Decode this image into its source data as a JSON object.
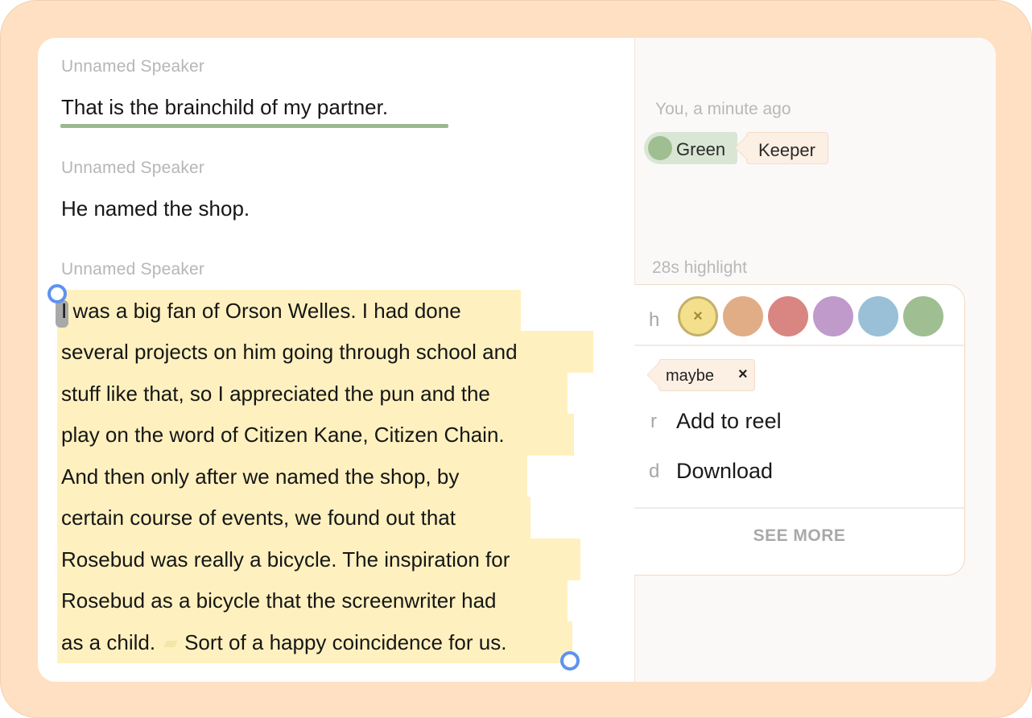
{
  "transcript": {
    "blocks": [
      {
        "speaker": "Unnamed Speaker",
        "text": "That is the brainchild of my partner."
      },
      {
        "speaker": "Unnamed Speaker",
        "text": "He named the shop."
      },
      {
        "speaker": "Unnamed Speaker",
        "lines": [
          "I was a big fan of Orson Welles. I had done",
          "several projects on him going through school and",
          "stuff like that, so I appreciated the pun and the",
          "play on the word of Citizen Kane, Citizen Chain.",
          "And then only after we named the shop, by",
          "certain course of events, we found out that",
          "Rosebud was really a bicycle. The inspiration for",
          "Rosebud as a bicycle that the screenwriter had",
          "as a child."
        ],
        "last_line_tail": "Sort of a happy coincidence for us."
      }
    ]
  },
  "comment": {
    "meta": "You, a minute ago",
    "color_tag": "Green",
    "tag": "Keeper",
    "colors": {
      "green_dot": "#9fbe92",
      "green_bg": "#d9e6d4"
    }
  },
  "popup": {
    "meta": "28s highlight",
    "color_key": "h",
    "swatches": [
      {
        "name": "yellow",
        "color": "#f4e08c",
        "selected": true,
        "mark": "×"
      },
      {
        "name": "orange",
        "color": "#e0ad87"
      },
      {
        "name": "red",
        "color": "#d98582"
      },
      {
        "name": "purple",
        "color": "#bf9acb"
      },
      {
        "name": "blue",
        "color": "#99c0d6"
      },
      {
        "name": "green",
        "color": "#9fbe92"
      }
    ],
    "tag": {
      "label": "maybe",
      "remove": "×"
    },
    "actions": [
      {
        "key": "r",
        "label": "Add to reel"
      },
      {
        "key": "d",
        "label": "Download"
      }
    ],
    "see_more": "SEE MORE"
  },
  "colors": {
    "highlight": "#fff1bf",
    "handle": "#5d93f0",
    "frame": "#ffe0c3"
  }
}
